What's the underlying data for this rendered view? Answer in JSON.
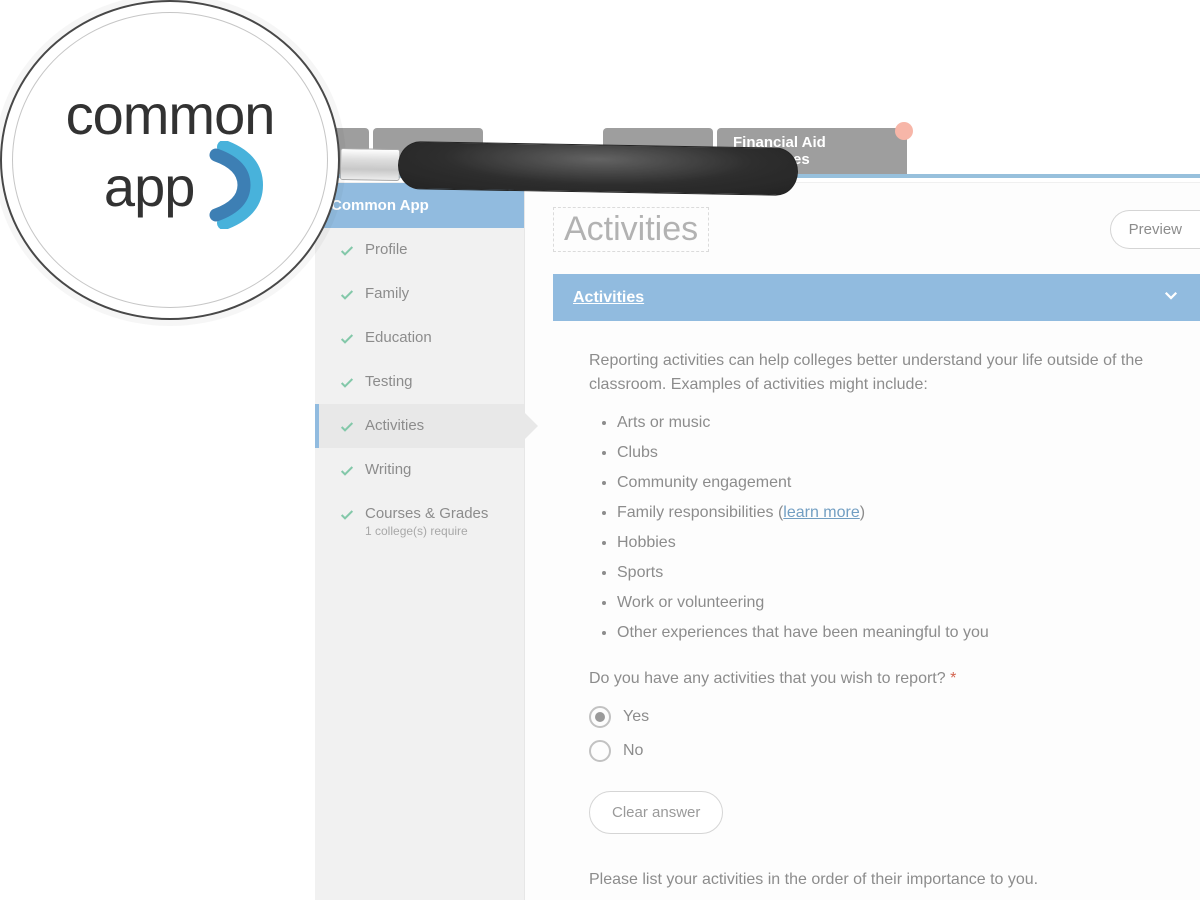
{
  "brand": {
    "line1": "common",
    "line2": "app"
  },
  "tabs": {
    "financial_aid": "Financial Aid Resources"
  },
  "sidebar": {
    "header": "Common App",
    "items": [
      {
        "label": "Profile",
        "completed": true
      },
      {
        "label": "Family",
        "completed": true
      },
      {
        "label": "Education",
        "completed": true
      },
      {
        "label": "Testing",
        "completed": true
      },
      {
        "label": "Activities",
        "completed": true,
        "selected": true
      },
      {
        "label": "Writing",
        "completed": true
      },
      {
        "label": "Courses & Grades",
        "completed": true,
        "sublabel": "1 college(s) require"
      }
    ]
  },
  "page": {
    "title": "Activities",
    "preview_label": "Preview",
    "accordion_title": "Activities",
    "intro": "Reporting activities can help colleges better understand your life outside of the classroom. Examples of activities might include:",
    "examples": [
      "Arts or music",
      "Clubs",
      "Community engagement",
      "Family responsibilities",
      "Hobbies",
      "Sports",
      "Work or volunteering",
      "Other experiences that have been meaningful to you"
    ],
    "learn_more": "learn more",
    "question": "Do you have any activities that you wish to report?",
    "required_marker": "*",
    "options": {
      "yes": "Yes",
      "no": "No",
      "selected": "yes"
    },
    "clear_label": "Clear answer",
    "closing": "Please list your activities in the order of their importance to you."
  }
}
